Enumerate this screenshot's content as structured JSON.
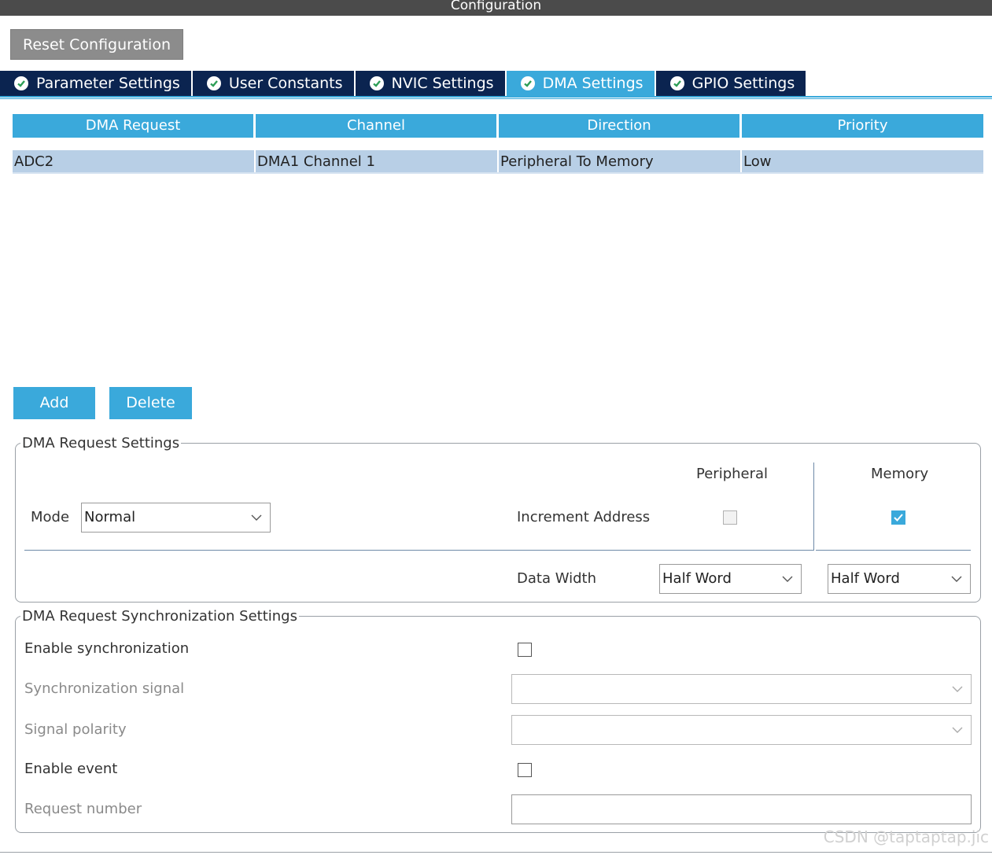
{
  "window": {
    "title": "Configuration"
  },
  "toolbar": {
    "reset_label": "Reset Configuration"
  },
  "tabs": [
    {
      "label": "Parameter Settings",
      "active": false
    },
    {
      "label": "User Constants",
      "active": false
    },
    {
      "label": "NVIC Settings",
      "active": false
    },
    {
      "label": "DMA Settings",
      "active": true
    },
    {
      "label": "GPIO Settings",
      "active": false
    }
  ],
  "dma_table": {
    "headers": [
      "DMA Request",
      "Channel",
      "Direction",
      "Priority"
    ],
    "rows": [
      [
        "ADC2",
        "DMA1 Channel 1",
        "Peripheral To Memory",
        "Low"
      ]
    ]
  },
  "actions": {
    "add_label": "Add",
    "delete_label": "Delete"
  },
  "request_settings": {
    "legend": "DMA Request Settings",
    "peripheral_header": "Peripheral",
    "memory_header": "Memory",
    "mode_label": "Mode",
    "mode_value": "Normal",
    "increment_label": "Increment Address",
    "peripheral_increment": false,
    "memory_increment": true,
    "data_width_label": "Data Width",
    "peripheral_width": "Half Word",
    "memory_width": "Half Word"
  },
  "sync_settings": {
    "legend": "DMA Request Synchronization Settings",
    "enable_sync_label": "Enable synchronization",
    "sync_signal_label": "Synchronization signal",
    "signal_polarity_label": "Signal polarity",
    "enable_event_label": "Enable event",
    "request_number_label": "Request number"
  },
  "watermark": "CSDN @taptaptap.jic",
  "colors": {
    "accent": "#3aa9db",
    "tab_dark": "#0b2450",
    "titlebar": "#4b4b4b",
    "row_selected": "#b8cfe6"
  }
}
